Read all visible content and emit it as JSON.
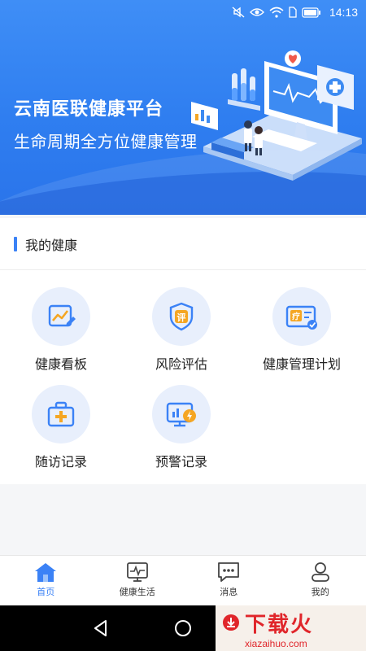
{
  "status_bar": {
    "time": "14:13"
  },
  "hero": {
    "title": "云南医联健康平台",
    "subtitle": "生命周期全方位健康管理"
  },
  "section": {
    "title": "我的健康"
  },
  "tiles": [
    {
      "label": "健康看板",
      "icon": "chart-edit-icon"
    },
    {
      "label": "风险评估",
      "icon": "shield-evaluate-icon"
    },
    {
      "label": "健康管理计划",
      "icon": "treatment-plan-icon"
    },
    {
      "label": "随访记录",
      "icon": "medical-kit-icon"
    },
    {
      "label": "预警记录",
      "icon": "monitor-alert-icon"
    }
  ],
  "bottom_nav": [
    {
      "label": "首页",
      "icon": "home-icon",
      "active": true
    },
    {
      "label": "健康生活",
      "icon": "pulse-monitor-icon",
      "active": false
    },
    {
      "label": "消息",
      "icon": "message-icon",
      "active": false
    },
    {
      "label": "我的",
      "icon": "user-icon",
      "active": false
    }
  ],
  "watermark": {
    "text": "下载火",
    "url": "xiazaihuo.com"
  },
  "colors": {
    "accent": "#3b82f6",
    "hero": "#2f7ef0",
    "icon_orange": "#f5a623",
    "tile_bg": "#e8effc"
  }
}
